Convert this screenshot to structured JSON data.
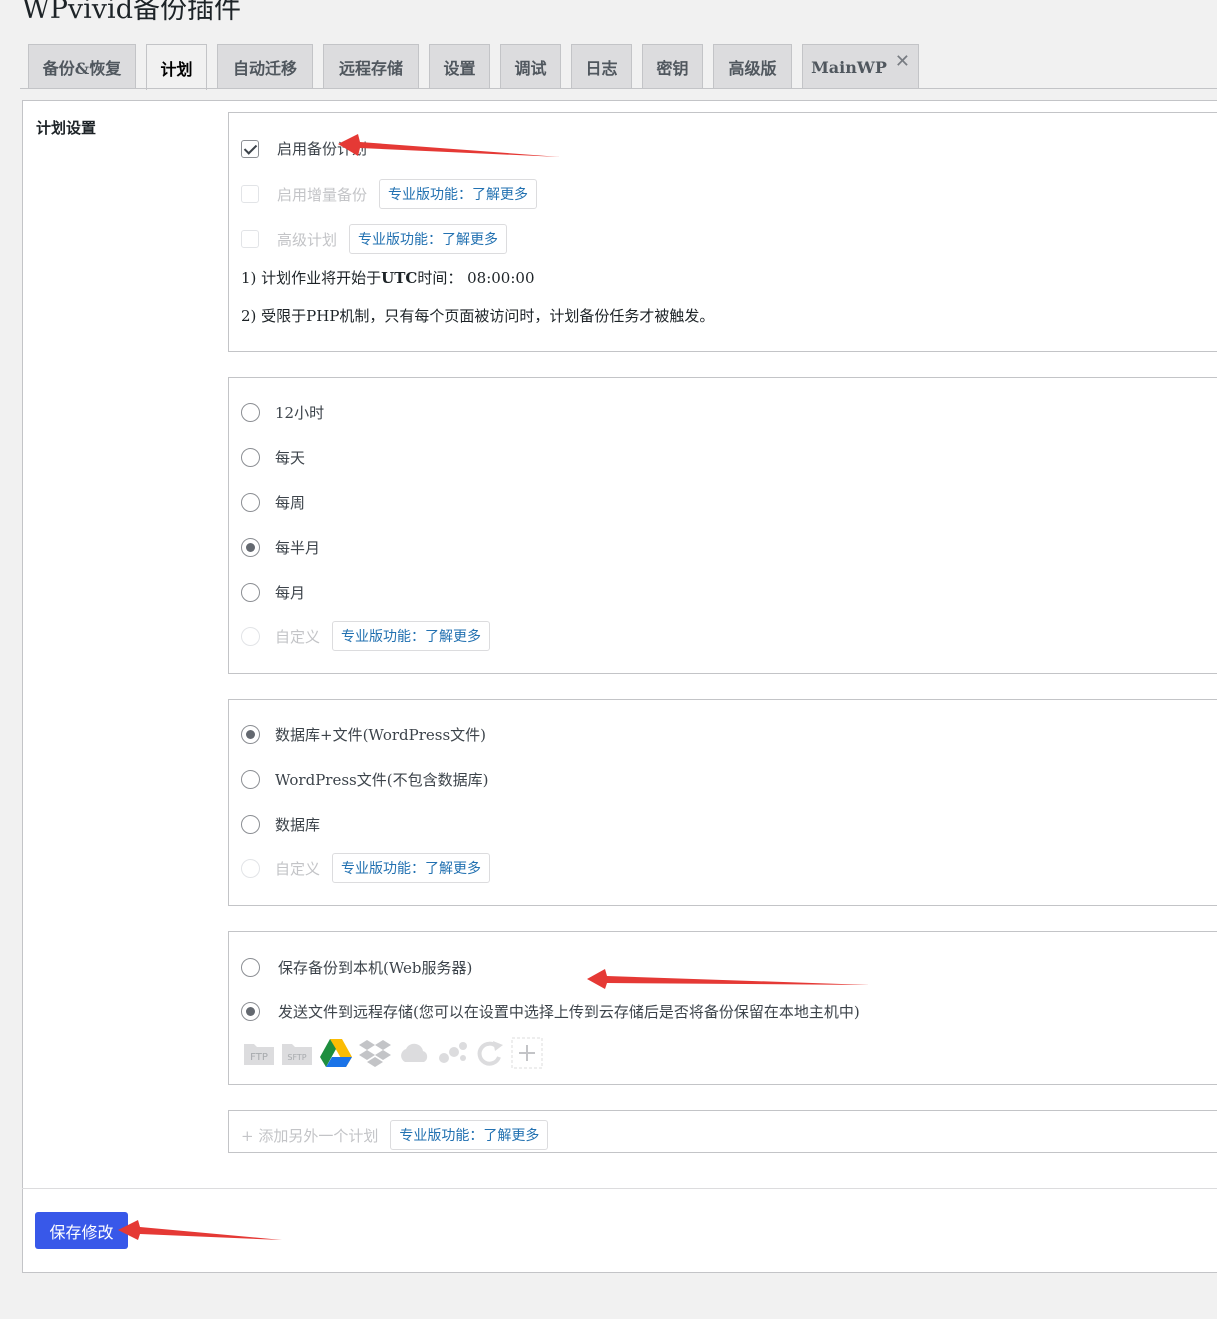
{
  "page": {
    "title": "WPvivid备份插件"
  },
  "tabs": [
    {
      "label": "备份&恢复",
      "active": false
    },
    {
      "label": "计划",
      "active": true
    },
    {
      "label": "自动迁移",
      "active": false
    },
    {
      "label": "远程存储",
      "active": false
    },
    {
      "label": "设置",
      "active": false
    },
    {
      "label": "调试",
      "active": false
    },
    {
      "label": "日志",
      "active": false
    },
    {
      "label": "密钥",
      "active": false
    },
    {
      "label": "高级版",
      "active": false
    },
    {
      "label": "MainWP",
      "active": false,
      "close": "✕"
    }
  ],
  "schedule": {
    "section_label": "计划设置",
    "enable_backup": {
      "label": "启用备份计划",
      "checked": true
    },
    "incremental": {
      "label": "启用增量备份",
      "checked": false,
      "disabled": true
    },
    "advanced": {
      "label": "高级计划",
      "checked": false,
      "disabled": true
    },
    "pro": {
      "prefix": "专业版功能：",
      "more": "了解更多"
    },
    "note1_prefix": "1) 计划作业将开始于",
    "note1_strong": "UTC",
    "note1_suffix": "时间：  08:00:00",
    "note2": "2) 受限于PHP机制，只有每个页面被访问时，计划备份任务才被触发。"
  },
  "frequency": {
    "options": [
      {
        "label": "12小时",
        "checked": false
      },
      {
        "label": "每天",
        "checked": false
      },
      {
        "label": "每周",
        "checked": false
      },
      {
        "label": "每半月",
        "checked": true
      },
      {
        "label": "每月",
        "checked": false
      },
      {
        "label": "自定义",
        "checked": false,
        "disabled": true
      }
    ]
  },
  "content": {
    "options": [
      {
        "label": "数据库+文件(WordPress文件)",
        "checked": true
      },
      {
        "label": "WordPress文件(不包含数据库)",
        "checked": false
      },
      {
        "label": "数据库",
        "checked": false
      },
      {
        "label": "自定义",
        "checked": false,
        "disabled": true
      }
    ]
  },
  "destination": {
    "local": {
      "label": "保存备份到本机(Web服务器)",
      "checked": false
    },
    "remote": {
      "label": "发送文件到远程存储(您可以在设置中选择上传到云存储后是否将备份保留在本地主机中)",
      "checked": true
    },
    "icons": [
      "FTP",
      "SFTP",
      "google-drive-icon",
      "dropbox-icon",
      "onedrive-icon",
      "amazon-s3-icon",
      "sync-icon",
      "add-icon"
    ]
  },
  "add_schedule": {
    "label": "+ 添加另外一个计划"
  },
  "save_button": {
    "label": "保存修改"
  },
  "colors": {
    "primary": "#3858e9",
    "link": "#2271b1",
    "arrow": "#e53935"
  }
}
